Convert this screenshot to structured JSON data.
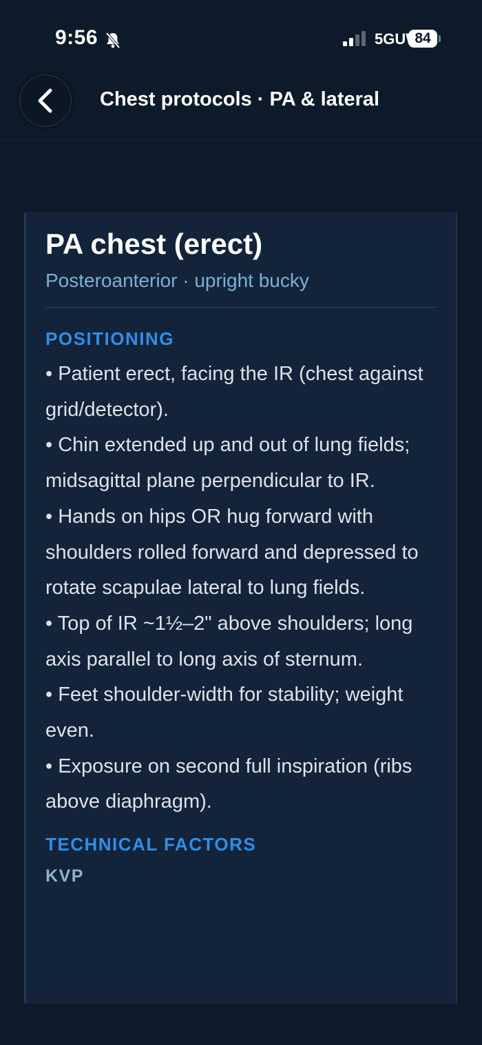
{
  "status_bar": {
    "time": "9:56",
    "network": "5GUW",
    "battery": "84"
  },
  "header": {
    "title": "Chest protocols · PA & lateral"
  },
  "card": {
    "title": "PA chest (erect)",
    "subtitle": "Posteroanterior · upright bucky",
    "positioning_heading": "POSITIONING",
    "positioning_items": [
      "• Patient erect, facing the IR (chest against grid/detector).",
      "• Chin extended up and out of lung fields; midsagittal plane perpendicular to IR.",
      "• Hands on hips OR hug forward with shoulders rolled forward and depressed to rotate scapulae lateral to lung fields.",
      "• Top of IR ~1½–2\" above shoulders; long axis parallel to long axis of sternum.",
      "• Feet shoulder-width for stability; weight even.",
      "• Exposure on second full inspiration (ribs above diaphragm)."
    ],
    "technical_heading": "TECHNICAL FACTORS",
    "kvp_label": "KVP"
  },
  "icons": {
    "back": "chevron-left-icon",
    "silent": "bell-slash-icon",
    "signal": "signal-bars-icon",
    "battery": "battery-icon"
  }
}
